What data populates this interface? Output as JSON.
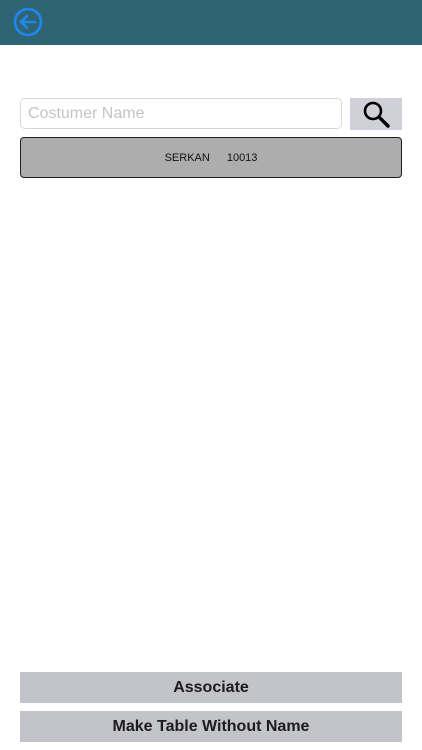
{
  "header": {
    "back_icon": "back-arrow-circle-icon",
    "bar_color": "#2e6474",
    "accent_color": "#1e88f0"
  },
  "search": {
    "placeholder": "Costumer Name",
    "value": "",
    "button_icon": "search-icon"
  },
  "results": [
    {
      "name": "SERKAN",
      "code": "10013"
    }
  ],
  "footer": {
    "associate_label": "Associate",
    "make_table_label": "Make Table Without Name"
  }
}
